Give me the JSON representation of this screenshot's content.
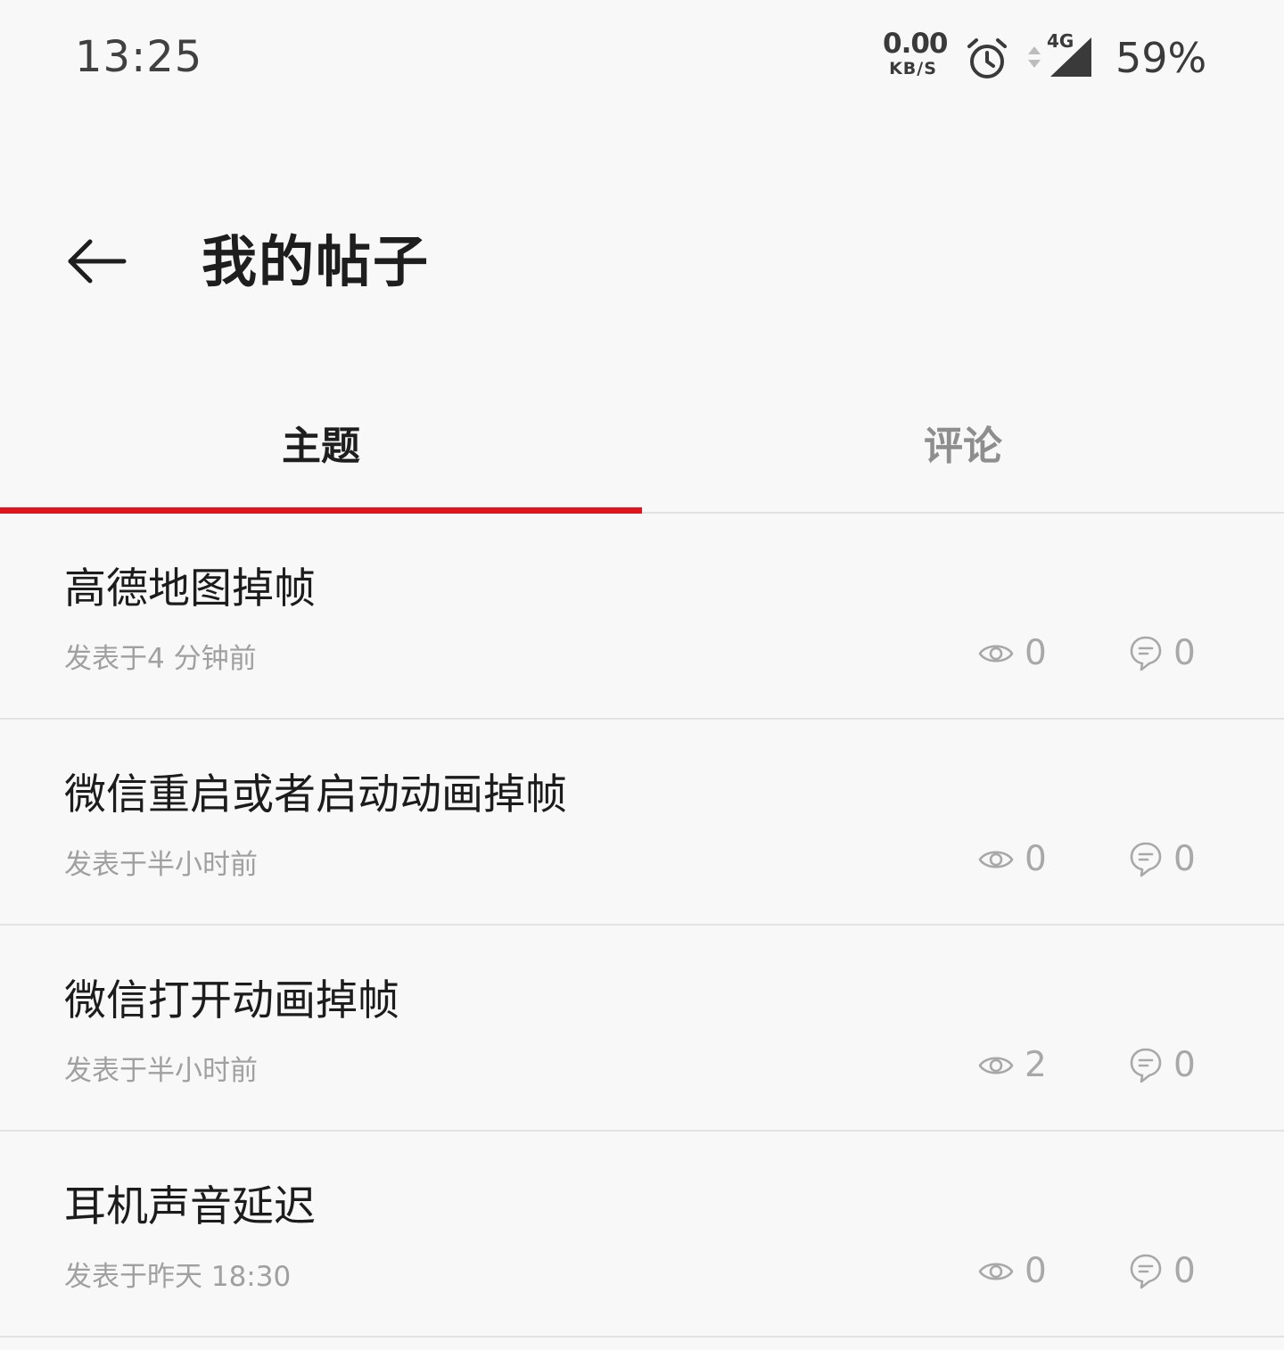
{
  "status_bar": {
    "time": "13:25",
    "net_speed_value": "0.00",
    "net_speed_unit": "KB/S",
    "network_type": "4G",
    "battery": "59%",
    "icons": [
      "alarm-icon",
      "data-arrows-icon",
      "signal-icon"
    ]
  },
  "header": {
    "title": "我的帖子",
    "back_icon": "back-arrow-icon"
  },
  "tabs": [
    {
      "label": "主题",
      "selected": true
    },
    {
      "label": "评论",
      "selected": false
    }
  ],
  "posts": [
    {
      "title": "高德地图掉帧",
      "meta": "发表于4 分钟前",
      "views": "0",
      "comments": "0"
    },
    {
      "title": "微信重启或者启动动画掉帧",
      "meta": "发表于半小时前",
      "views": "0",
      "comments": "0"
    },
    {
      "title": "微信打开动画掉帧",
      "meta": "发表于半小时前",
      "views": "2",
      "comments": "0"
    },
    {
      "title": "耳机声音延迟",
      "meta": "发表于昨天 18:30",
      "views": "0",
      "comments": "0"
    }
  ],
  "colors": {
    "accent": "#e0141e",
    "background": "#f8f8f8",
    "primary_text": "#1c1c1c",
    "secondary_text": "#a0a0a0",
    "divider": "#e2e2e2"
  }
}
